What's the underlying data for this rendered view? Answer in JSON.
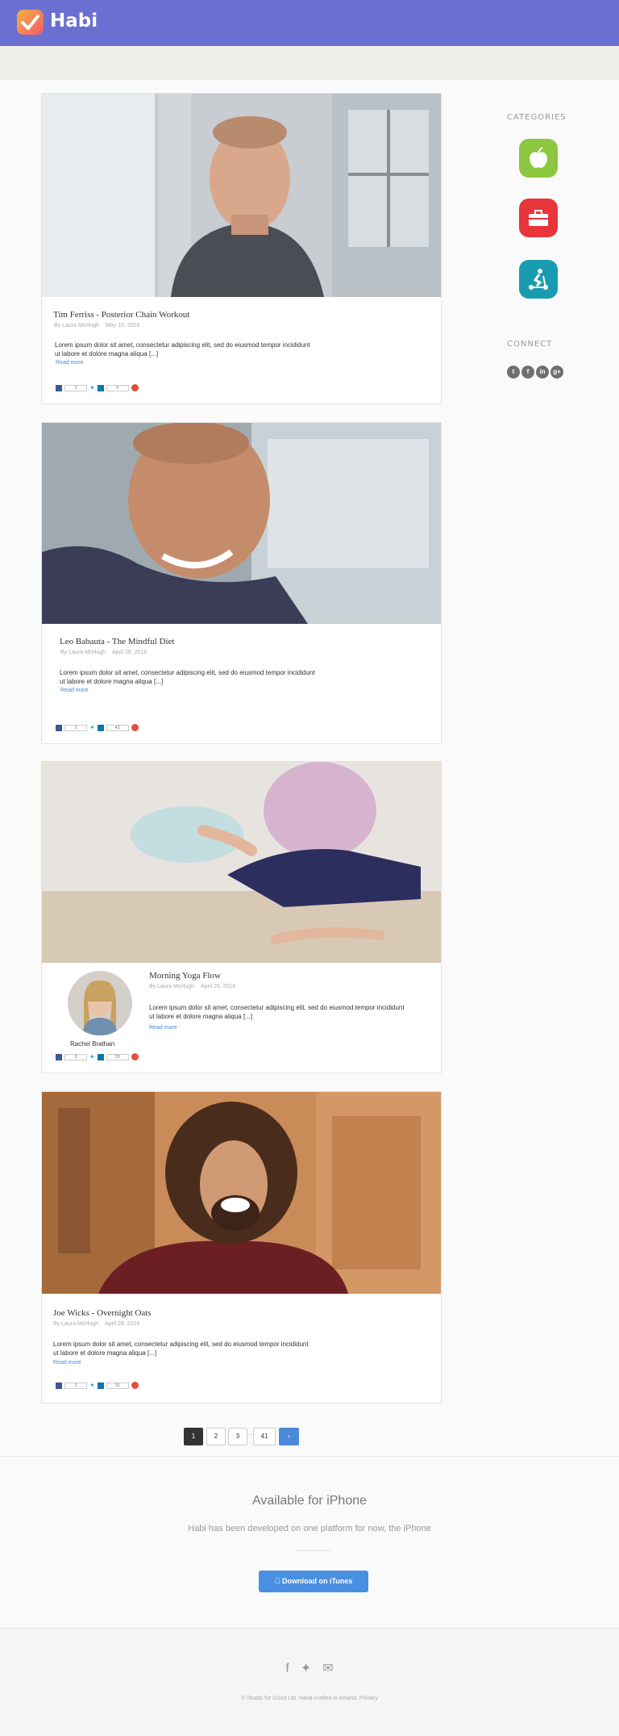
{
  "header": {
    "app_name": "Habi",
    "brand_color": "#6b6fd1"
  },
  "posts": [
    {
      "title": "Tim Ferriss - Posterior Chain Workout",
      "author": "By Laura McHugh",
      "date": "May 10, 2016",
      "excerpt": "Lorem ipsum dolor sit amet, consectetur adipiscing elit, sed do eiusmod tempor incididunt ut labore et dolore magna aliqua [...]",
      "read_more": "Read more",
      "fb_count": "1",
      "li_count": "0"
    },
    {
      "title": "Leo Babauta - The Mindful Diet",
      "author": "By Laura McHugh",
      "date": "April 26, 2016",
      "excerpt": "Lorem ipsum dolor sit amet, consectetur adipiscing elit, sed do eiusmod tempor incididunt ut labore et dolore magna aliqua [...]",
      "read_more": "Read more",
      "fb_count": "3",
      "li_count": "43"
    },
    {
      "title": "Morning Yoga Flow",
      "author": "By Laura McHugh",
      "date": "April 26, 2016",
      "excerpt": "Lorem ipsum dolor sit amet, consectetur adipiscing elit, sed do eiusmod tempor incididunt ut labore et dolore magna aliqua [...]",
      "read_more": "Read more",
      "fb_count": "0",
      "li_count": "23",
      "author_card_name": "Rachel Brathan"
    },
    {
      "title": "Joe Wicks - Overnight Oats",
      "author": "By Laura McHugh",
      "date": "April 26, 2016",
      "excerpt": "Lorem ipsum dolor sit amet, consectetur adipiscing elit, sed do eiusmod tempor incididunt ut labore et dolore magna aliqua [...]",
      "read_more": "Read more",
      "fb_count": "2",
      "li_count": "31"
    }
  ],
  "sidebar": {
    "categories_heading": "CATEGORIES",
    "categories": [
      {
        "icon": "apple-icon",
        "color": "#8dc63f"
      },
      {
        "icon": "briefcase-icon",
        "color": "#e8343b"
      },
      {
        "icon": "scooter-icon",
        "color": "#1a9cb0"
      }
    ],
    "connect_heading": "CONNECT",
    "social": [
      {
        "icon": "twitter-icon",
        "glyph": "t"
      },
      {
        "icon": "facebook-icon",
        "glyph": "f"
      },
      {
        "icon": "linkedin-icon",
        "glyph": "in"
      },
      {
        "icon": "googleplus-icon",
        "glyph": "g+"
      }
    ]
  },
  "pagination": {
    "pages": [
      "1",
      "2",
      "3",
      "...",
      "41"
    ],
    "next": "›"
  },
  "promo": {
    "title": "Available for iPhone",
    "subtitle": "Habi has been developed on one platform for now, the iPhone",
    "button": "Download on iTunes",
    "button_color": "#4a90e2"
  },
  "footer": {
    "copyright": "© Studio for Good Ltd. Hand-crafted in Ireland. Privacy"
  }
}
